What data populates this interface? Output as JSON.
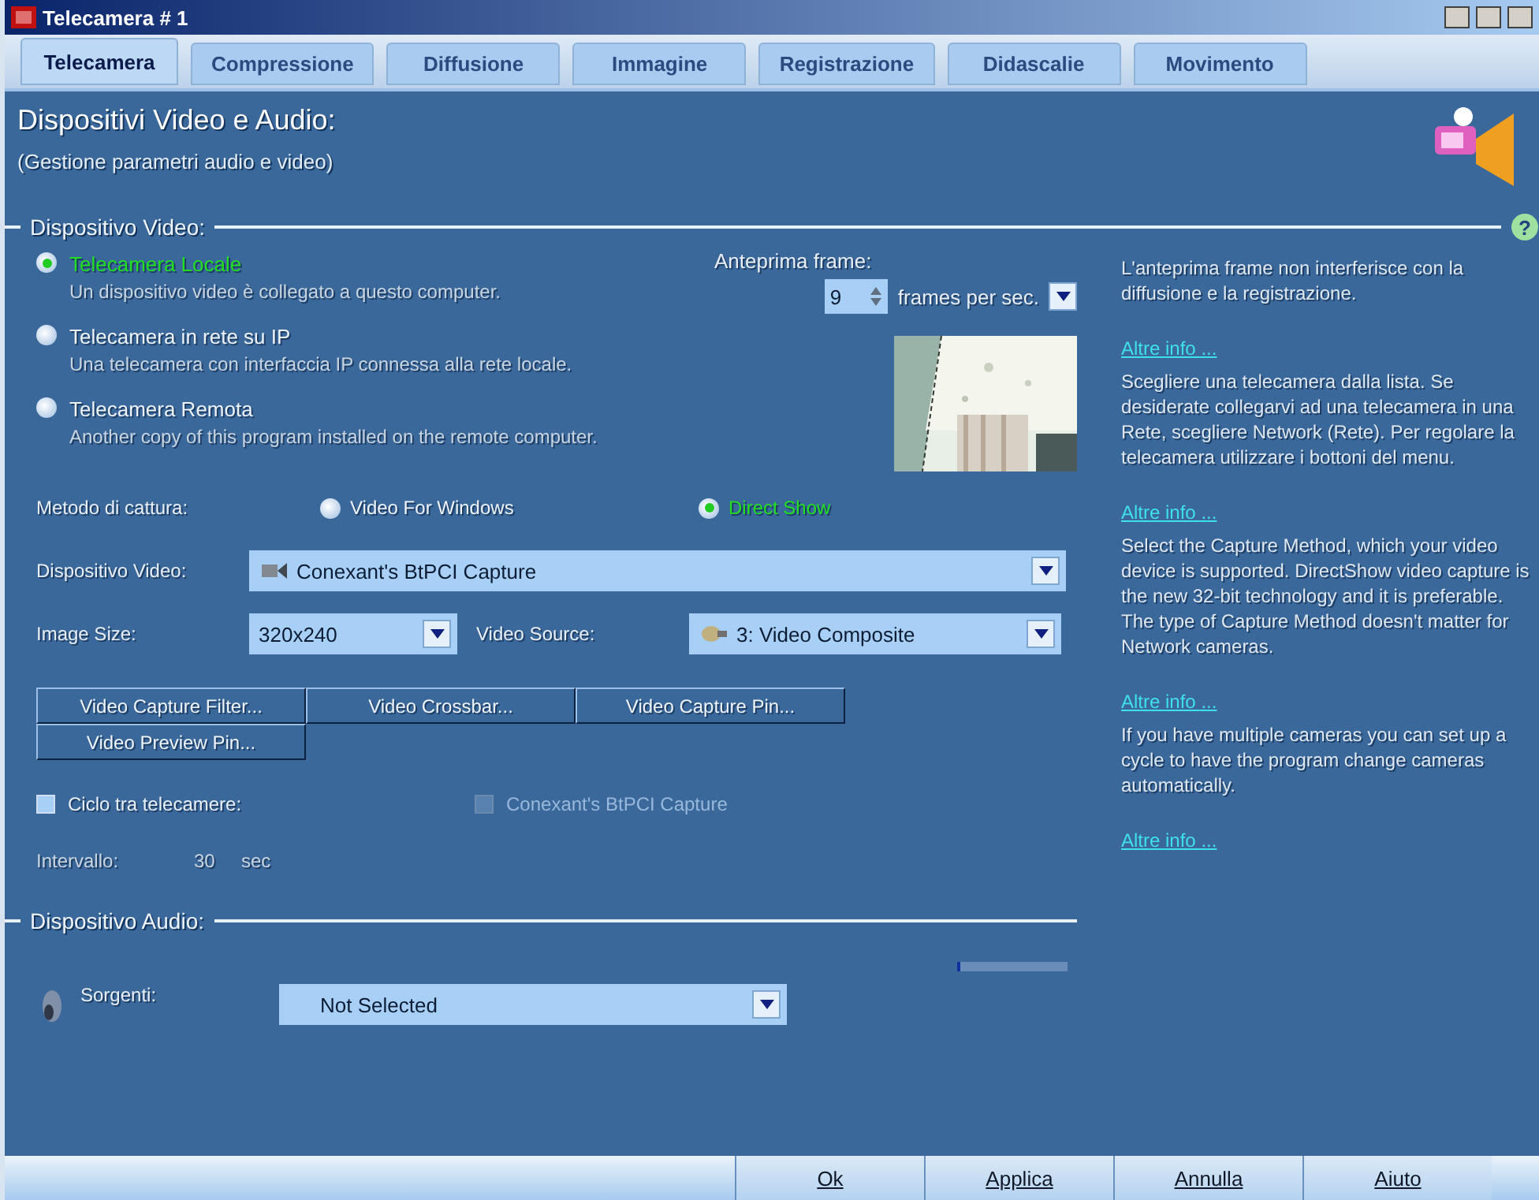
{
  "window": {
    "title": "Telecamera # 1"
  },
  "tabs": [
    {
      "label": "Telecamera",
      "selected": true
    },
    {
      "label": "Compressione",
      "selected": false
    },
    {
      "label": "Diffusione",
      "selected": false
    },
    {
      "label": "Immagine",
      "selected": false
    },
    {
      "label": "Registrazione",
      "selected": false
    },
    {
      "label": "Didascalie",
      "selected": false
    },
    {
      "label": "Movimento",
      "selected": false
    }
  ],
  "header": {
    "title": "Dispositivi Video e Audio:",
    "subtitle": "(Gestione parametri audio e video)"
  },
  "video_section": {
    "title": "Dispositivo Video:",
    "help_button": "?",
    "sources": [
      {
        "label": "Telecamera Locale",
        "description": "Un dispositivo video è collegato a questo computer.",
        "selected": true
      },
      {
        "label": "Telecamera in rete su IP",
        "description": "Una telecamera con interfaccia IP connessa alla rete locale.",
        "selected": false
      },
      {
        "label": "Telecamera Remota",
        "description": "Another copy of this program installed on the remote computer.",
        "selected": false
      }
    ],
    "preview": {
      "label": "Anteprima frame:",
      "fps": "9",
      "unit": "frames per sec."
    },
    "capture_method": {
      "label": "Metodo di cattura:",
      "options": [
        {
          "label": "Video For Windows",
          "selected": false
        },
        {
          "label": "Direct Show",
          "selected": true
        }
      ]
    },
    "device": {
      "label": "Dispositivo Video:",
      "value": "Conexant's BtPCI Capture"
    },
    "image_size": {
      "label": "Image Size:",
      "value": "320x240"
    },
    "video_source": {
      "label": "Video Source:",
      "value": "3: Video Composite"
    },
    "buttons": [
      "Video Capture Filter...",
      "Video Crossbar...",
      "Video Capture Pin...",
      "Video Preview Pin..."
    ],
    "cycle": {
      "label": "Ciclo tra telecamere:",
      "checked": false,
      "camera": {
        "label": "Conexant's BtPCI Capture",
        "checked": false,
        "disabled": true
      }
    },
    "interval": {
      "label": "Intervallo:",
      "value": "30",
      "unit": "sec"
    }
  },
  "audio_section": {
    "title": "Dispositivo Audio:",
    "sources": {
      "label": "Sorgenti:",
      "value": "Not Selected"
    }
  },
  "help": [
    {
      "text": "L'anteprima frame non interferisce con la diffusione e la registrazione."
    },
    {
      "link": "Altre info ...",
      "text": "Scegliere una telecamera dalla lista. Se desiderate collegarvi ad una telecamera in una Rete, scegliere Network (Rete). Per regolare la telecamera utilizzare i bottoni del menu."
    },
    {
      "link": "Altre info ...",
      "text": "Select the Capture Method, which your video device is supported. DirectShow video capture is the new 32-bit technology and it is preferable. The type of Capture Method doesn't matter for Network cameras."
    },
    {
      "link": "Altre info ...",
      "text": "If you have multiple cameras you can set up a cycle to have the program change cameras automatically."
    },
    {
      "link": "Altre info ..."
    }
  ],
  "footer": [
    "Ok",
    "Applica",
    "Annulla",
    "Aiuto"
  ]
}
